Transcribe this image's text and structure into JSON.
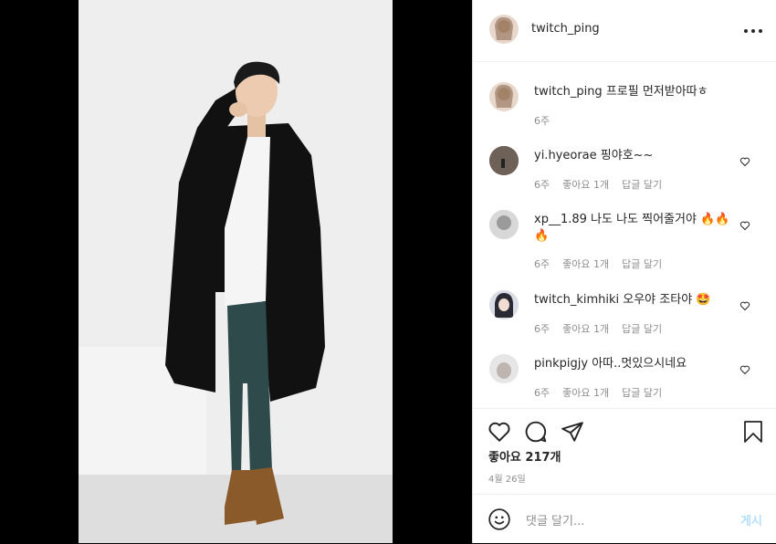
{
  "post": {
    "author": "twitch_ping",
    "more_label": "more options"
  },
  "caption": {
    "user": "twitch_ping",
    "text": "프로필 먼저받아따ㅎ",
    "time": "6주"
  },
  "comments": [
    {
      "user": "yi.hyeorae",
      "text": "핑야호~~",
      "time": "6주",
      "likes": "좋아요 1개",
      "reply": "답글 달기"
    },
    {
      "user": "xp__1.89",
      "text": "나도 나도 찍어줄거야 🔥🔥🔥",
      "time": "6주",
      "likes": "좋아요 1개",
      "reply": "답글 달기"
    },
    {
      "user": "twitch_kimhiki",
      "text": "오우야 조타야 🤩",
      "time": "6주",
      "likes": "좋아요 1개",
      "reply": "답글 달기"
    },
    {
      "user": "pinkpigjy",
      "text": "아따..멋있으시네요",
      "time": "6주",
      "likes": "좋아요 1개",
      "reply": "답글 달기"
    }
  ],
  "likes_count": "좋아요 217개",
  "date": "4월 26일",
  "add_comment": {
    "placeholder": "댓글 달기...",
    "post_label": "게시"
  },
  "icons": {
    "like": "heart-icon",
    "comment": "comment-icon",
    "share": "paper-plane-icon",
    "save": "bookmark-icon",
    "emoji": "smiley-icon"
  },
  "colors": {
    "text": "#262626",
    "muted": "#8e8e8e",
    "post_button": "#b2dffc"
  }
}
